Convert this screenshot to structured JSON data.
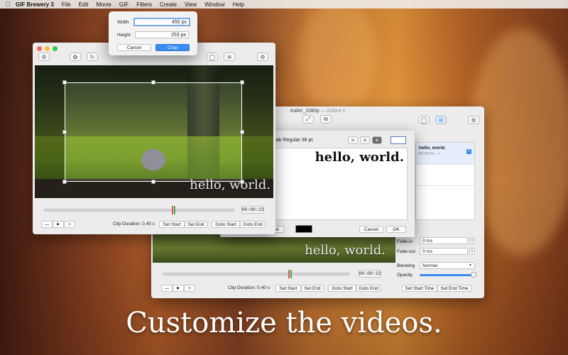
{
  "menubar": {
    "app": "GIF Brewery 3",
    "items": [
      "File",
      "Edit",
      "Movie",
      "GIF",
      "Filters",
      "Create",
      "View",
      "Window",
      "Help"
    ]
  },
  "crop_popover": {
    "width_label": "Width",
    "width_value": "450 px",
    "height_label": "Height",
    "height_value": "253 px",
    "cancel_label": "Cancel",
    "crop_label": "Crop"
  },
  "front_window": {
    "overlay_text": "hello, world.",
    "time": "00:00:22",
    "minus": "—",
    "play": "▶",
    "plus": "+",
    "clip_duration": "Clip Duration: 0.40 s",
    "set_start": "Set Start",
    "set_end": "Set End",
    "goto_start": "Goto Start",
    "goto_end": "Goto End"
  },
  "back_window": {
    "title": "trailer_1080p",
    "edited": "— Edited ▾",
    "overlay_text": "hello, world.",
    "time": "00:00:22",
    "minus": "—",
    "play": "▶",
    "plus": "+",
    "clip_duration": "Clip Duration: 0.40 s",
    "set_start": "Set Start",
    "set_end": "Set End",
    "goto_start": "Goto Start",
    "goto_end": "Goto End",
    "overlay_item_title": "hello, world.",
    "overlay_item_time": "00:00:00 - ∞",
    "fade_in_label": "Fade-in",
    "fade_in_value": "0 ms",
    "fade_out_label": "Fade-out",
    "fade_out_value": "0 ms",
    "blending_label": "Blending",
    "blending_value": "Normal",
    "opacity_label": "Opacity",
    "opacity": 1.0,
    "set_start_time": "Set Start Time",
    "set_end_time": "Set End Time"
  },
  "text_dialog": {
    "font": "ve Slab Regular 36 pt",
    "preview_text": "hello, world.",
    "size_value": "px",
    "cancel_label": "Cancel",
    "ok_label": "OK"
  },
  "caption": "Customize the videos.",
  "colors": {
    "accent": "#3b8cf0",
    "traffic_red": "#fc605c",
    "traffic_yellow": "#fdbc40",
    "traffic_green": "#34c84a"
  }
}
